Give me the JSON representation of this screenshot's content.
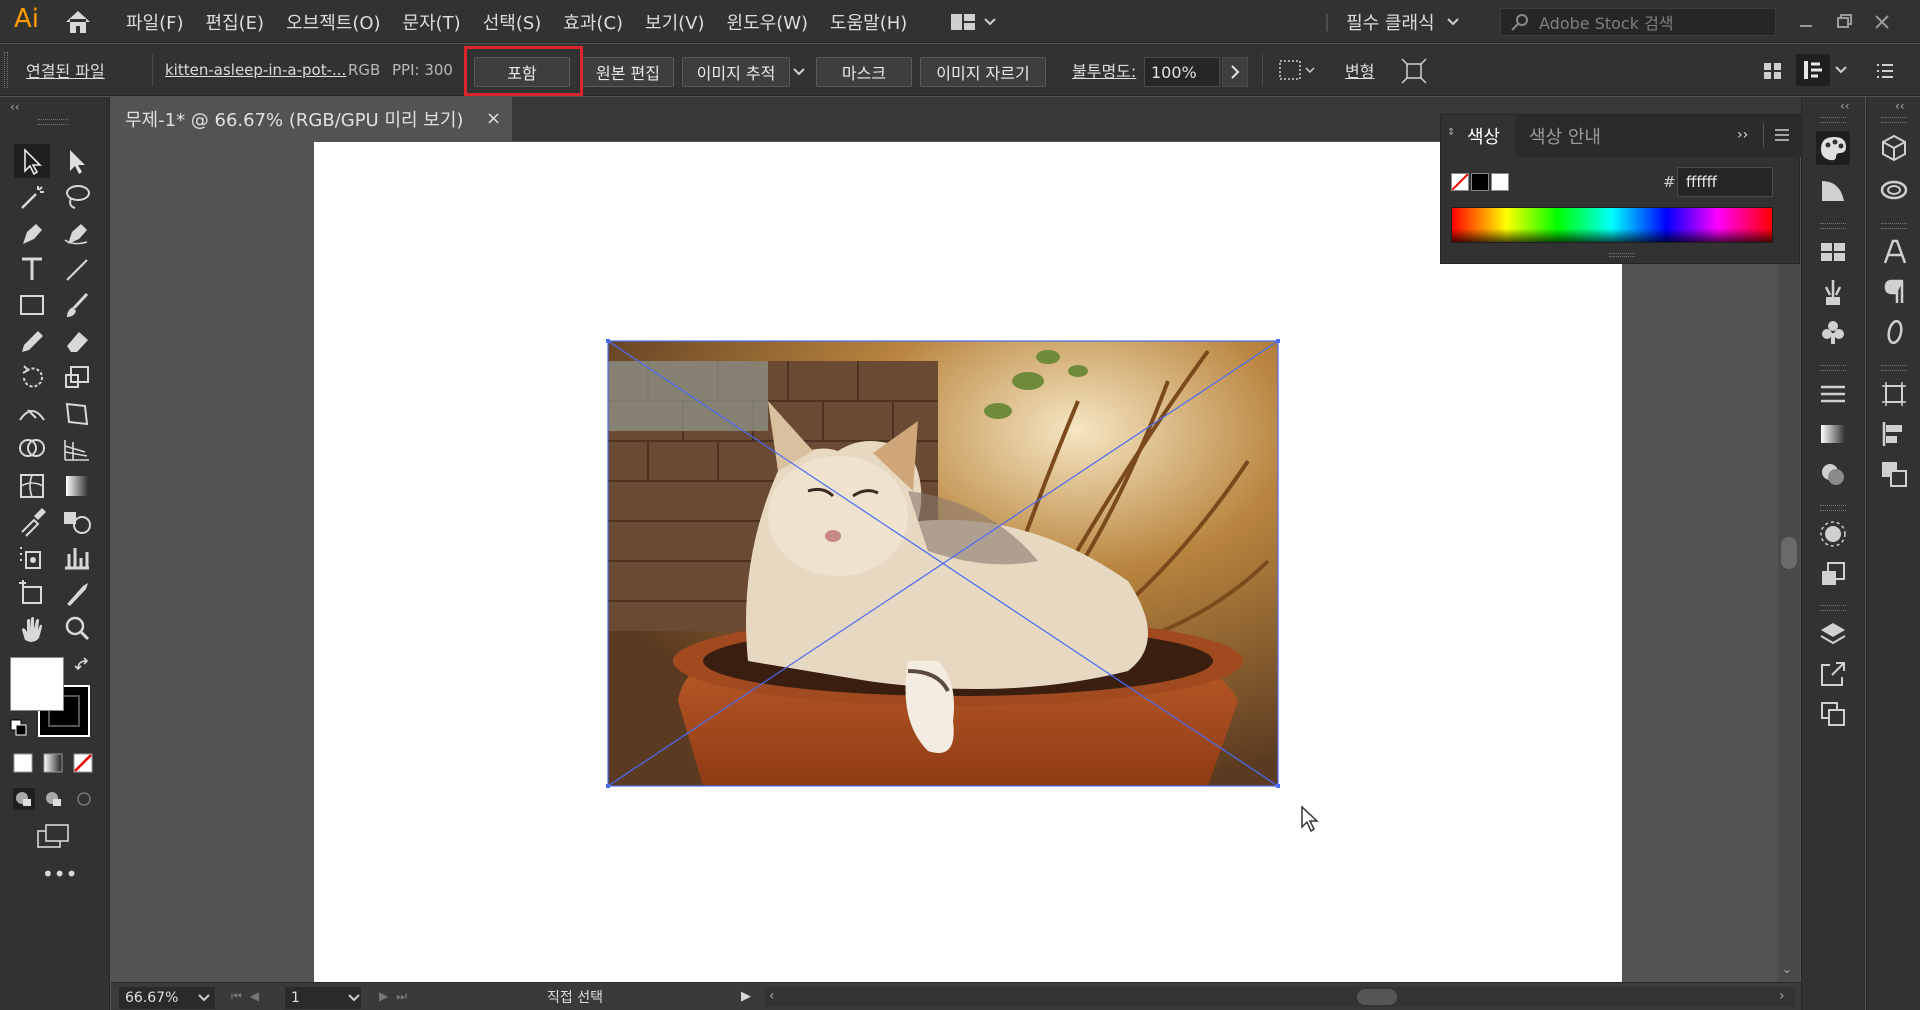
{
  "app": {
    "logo": "Ai"
  },
  "menu": {
    "items": [
      "파일(F)",
      "편집(E)",
      "오브젝트(O)",
      "문자(T)",
      "선택(S)",
      "효과(C)",
      "보기(V)",
      "윈도우(W)",
      "도움말(H)"
    ],
    "workspace": "필수 클래식",
    "stock_placeholder": "Adobe Stock 검색"
  },
  "control": {
    "linked_file": "연결된 파일",
    "filename": "kitten-asleep-in-a-pot-...",
    "color_mode": "RGB",
    "ppi": "PPI: 300",
    "embed": "포함",
    "edit_original": "원본 편집",
    "image_trace": "이미지 추적",
    "mask": "마스크",
    "crop_image": "이미지 자르기",
    "opacity_label": "불투명도:",
    "opacity_value": "100%",
    "transform": "변형"
  },
  "document": {
    "tab_title": "무제-1* @ 66.67% (RGB/GPU 미리 보기)",
    "close": "×"
  },
  "status": {
    "zoom": "66.67%",
    "page": "1",
    "tool": "직접 선택"
  },
  "color_panel": {
    "tab_color": "색상",
    "tab_guide": "색상 안내",
    "hash": "#",
    "hex": "ffffff"
  },
  "colors": {
    "accent_orange": "#ff9a00",
    "highlight_red": "#d8262c",
    "selection_blue": "#4a6cf7",
    "panel_bg": "#323232",
    "canvas_bg": "#535353"
  }
}
